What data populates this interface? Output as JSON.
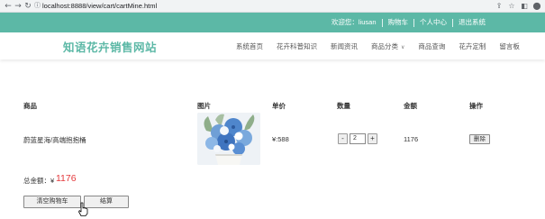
{
  "browser": {
    "url": "localhost:8888/view/cart/cartMine.html"
  },
  "topbar": {
    "welcome": "欢迎您：liusan",
    "cart": "购物车",
    "user_center": "个人中心",
    "logout": "退出系统"
  },
  "header": {
    "logo": "知语花卉销售网站",
    "nav": [
      "系统首页",
      "花卉科普知识",
      "新闻资讯",
      "商品分类",
      "商品查询",
      "花卉定制",
      "留言板"
    ]
  },
  "table": {
    "headers": {
      "product": "商品",
      "image": "图片",
      "price": "单价",
      "quantity": "数量",
      "amount": "金额",
      "action": "操作"
    },
    "rows": [
      {
        "name": "蔚蓝星海/高端抱抱桶",
        "price": "¥:588",
        "quantity": "2",
        "amount": "1176",
        "delete_label": "删除"
      }
    ]
  },
  "summary": {
    "total_label": "总金额：¥",
    "total_value": "1176"
  },
  "buttons": {
    "clear": "清空购物车",
    "checkout": "结算"
  },
  "colors": {
    "accent": "#5cb8a6",
    "price_red": "#e4393c"
  },
  "icons": [
    "back-icon",
    "forward-icon",
    "reload-icon",
    "info-icon",
    "share-icon",
    "star-icon",
    "sidebar-icon",
    "profile-icon"
  ]
}
